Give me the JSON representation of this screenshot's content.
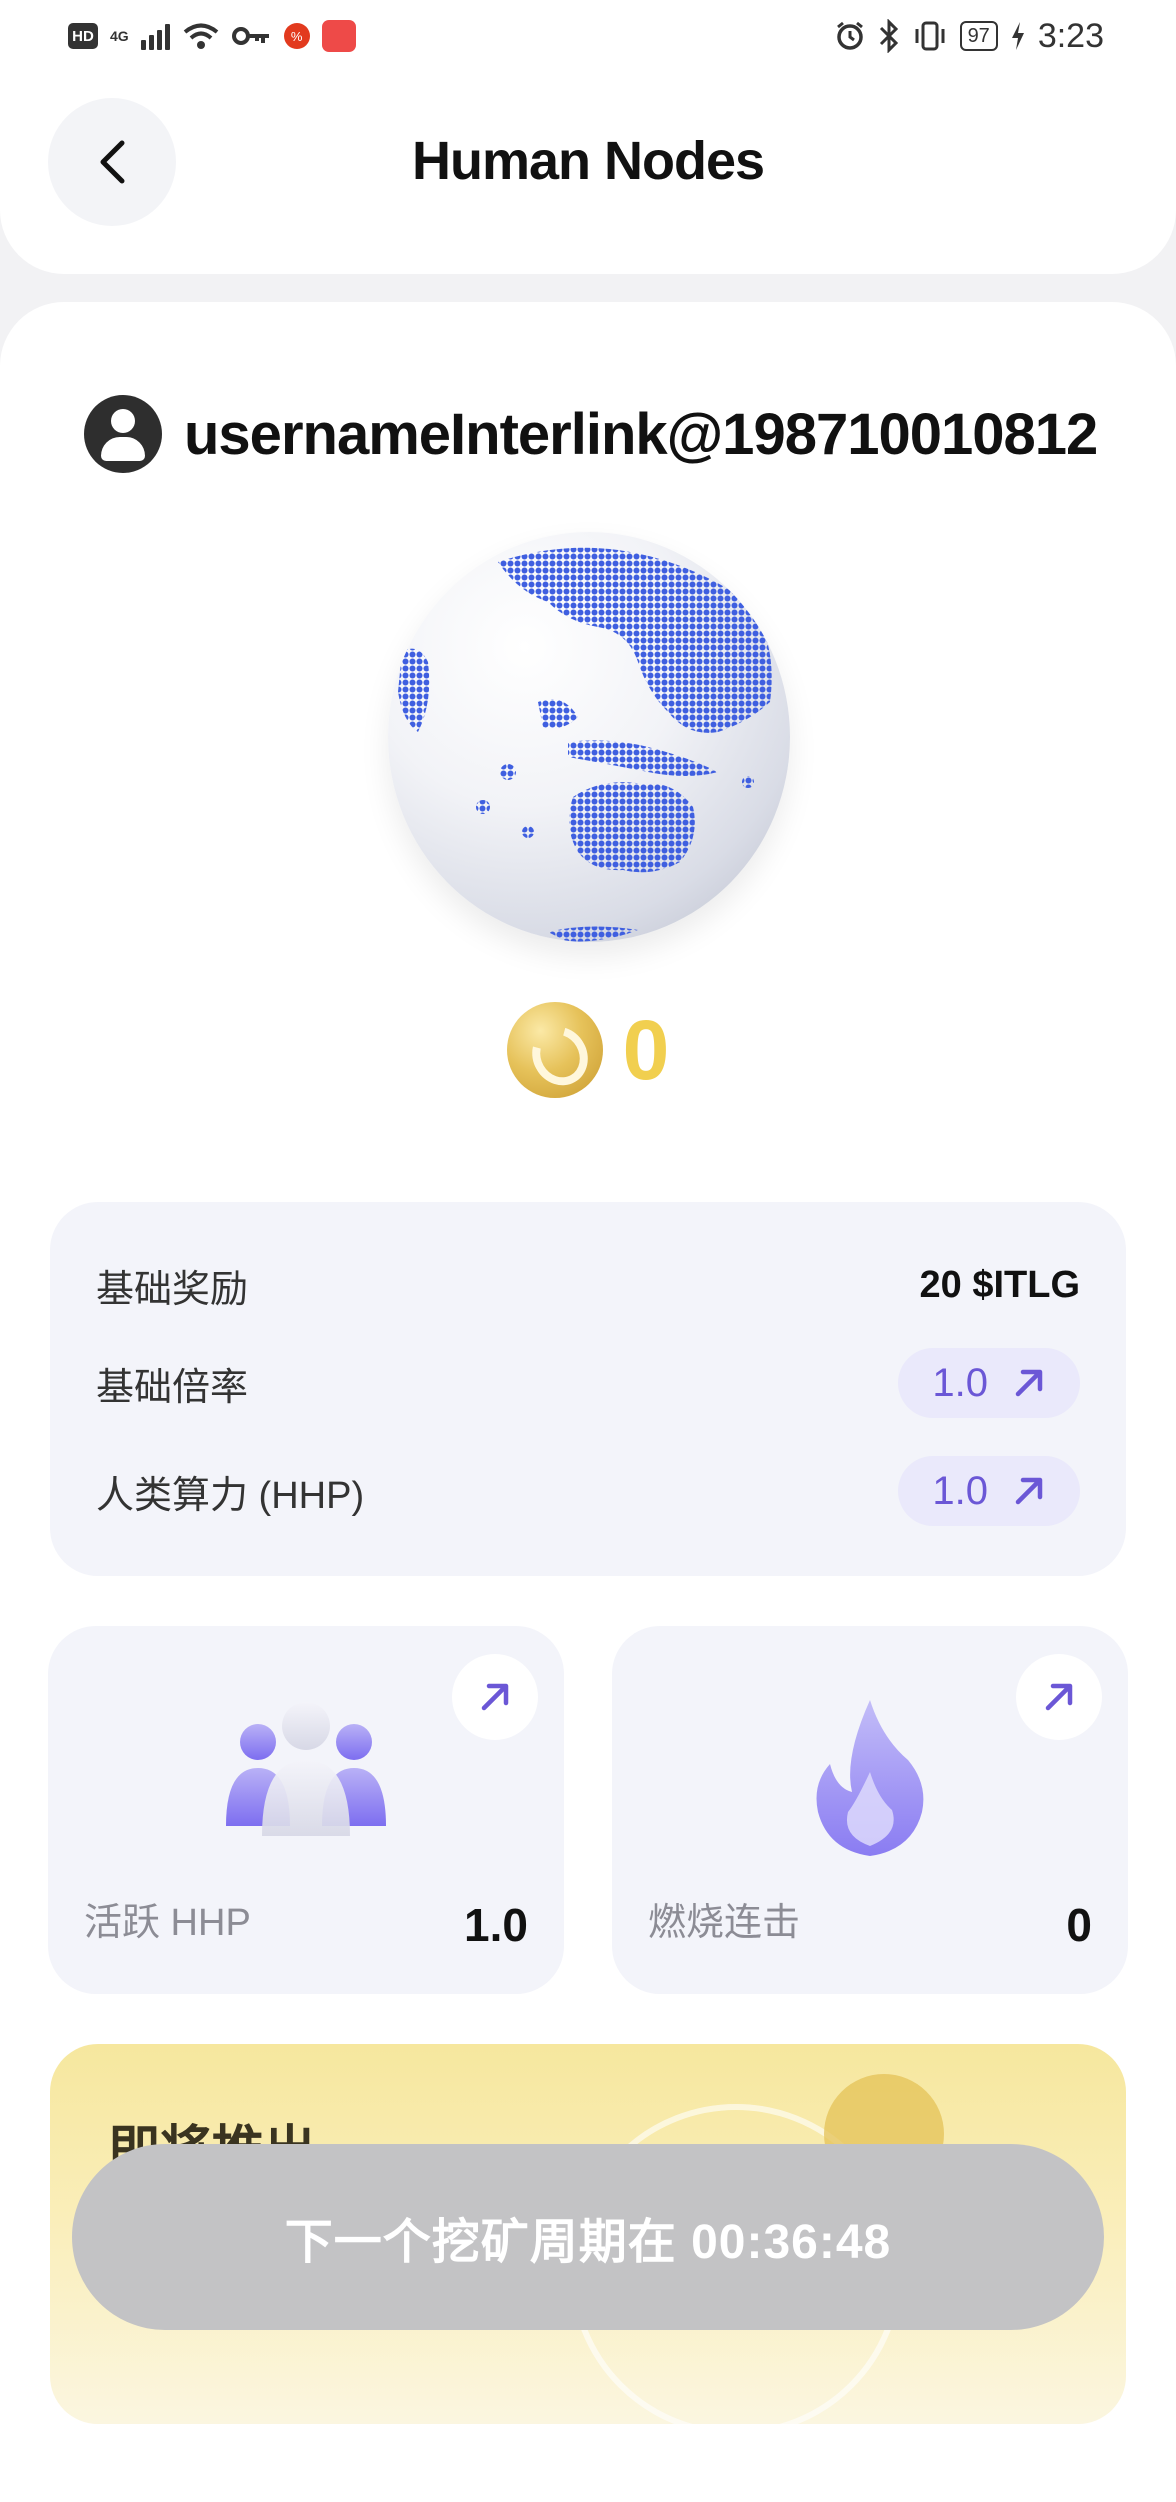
{
  "status_bar": {
    "hd": "HD",
    "network": "4G",
    "battery": "97",
    "time": "3:23"
  },
  "header": {
    "title": "Human Nodes",
    "back_icon": "chevron-left-icon"
  },
  "user": {
    "username": "usernameInterlink@198710010812",
    "avatar_icon": "user-avatar-icon"
  },
  "balance": {
    "value": "0",
    "coin_icon": "gold-coin-icon"
  },
  "info": {
    "rows": [
      {
        "label": "基础奖励",
        "value": "20 $ITLG"
      },
      {
        "label": "基础倍率",
        "value": "1.0"
      },
      {
        "label": "人类算力 (HHP)",
        "value": "1.0"
      }
    ]
  },
  "stats": [
    {
      "label": "活跃 HHP",
      "value": "1.0",
      "icon": "people-group-icon"
    },
    {
      "label": "燃烧连击",
      "value": "0",
      "icon": "flame-icon"
    }
  ],
  "promo": {
    "title": "即将推出"
  },
  "cta": {
    "label": "下一个挖矿周期在 00:36:48"
  },
  "colors": {
    "accent": "#6b57d6",
    "pill_bg": "#eae9fb",
    "card_bg": "#f3f4fa",
    "coin": "#f1cf4f",
    "cta_bg": "#c3c3c5",
    "globe_land": "#3f5fe0"
  }
}
